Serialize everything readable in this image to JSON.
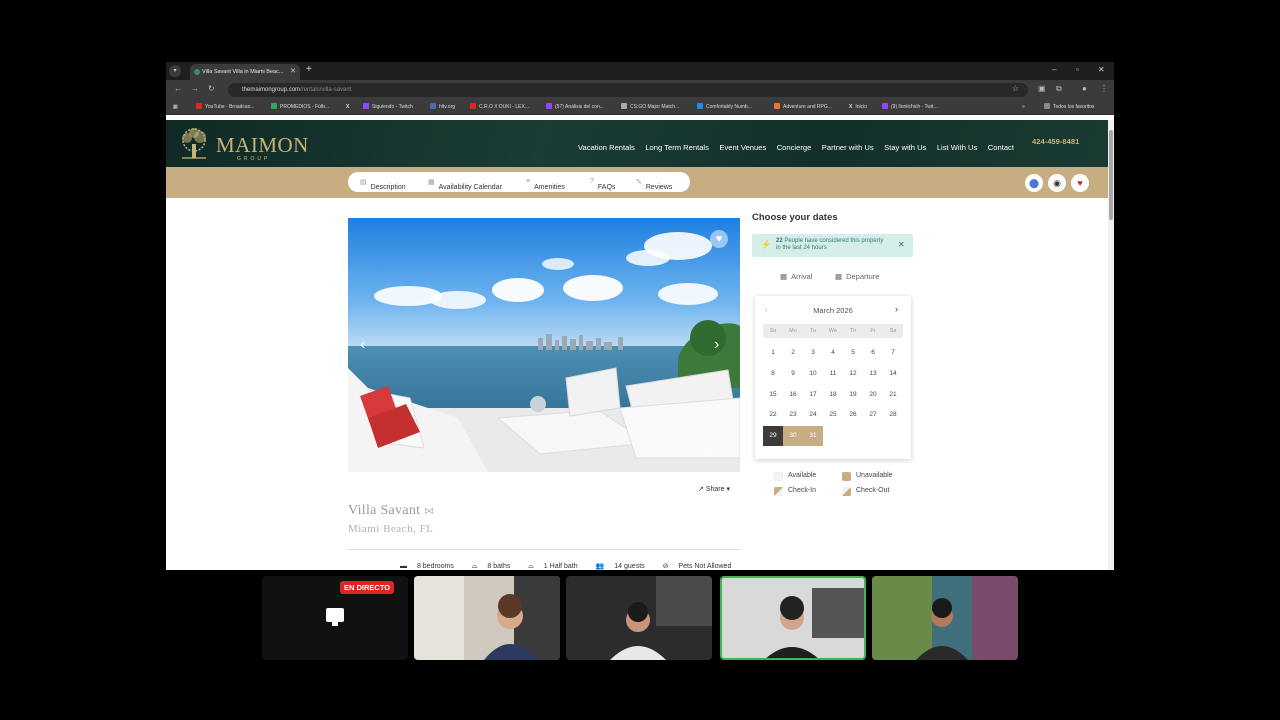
{
  "browser": {
    "tab_title": "Villa Savant Villa in Miami Beac...",
    "url_host": "themaimongroup.com",
    "url_path": "/rentals/villa-savant",
    "bookmarks": [
      {
        "label": "YouTube - Broadcas...",
        "color": "#e02424"
      },
      {
        "label": "PROMEDIOS - Fútb...",
        "color": "#3aa35a"
      },
      {
        "label": "",
        "color": "#000000"
      },
      {
        "label": "Siguiendo - Twitch",
        "color": "#9146ff"
      },
      {
        "label": "hltv.org",
        "color": "#4a6bb3"
      },
      {
        "label": "C.R.O X DUKI - LEX...",
        "color": "#e02424"
      },
      {
        "label": "(57) Análisis del con...",
        "color": "#9146ff"
      },
      {
        "label": "CS:GO Major Match...",
        "color": "#aaaaaa"
      },
      {
        "label": "Comfortably Numb...",
        "color": "#1e88e5"
      },
      {
        "label": "Adventure and RPG...",
        "color": "#e8772e"
      },
      {
        "label": "Inicio",
        "color": "#000000"
      },
      {
        "label": "(9) lloniichich - Twit...",
        "color": "#9146ff"
      }
    ],
    "bookmarks_folder": "Todos los favoritos"
  },
  "site": {
    "logo_text": "MAIMON",
    "logo_sub": "GROUP",
    "nav": [
      "Vacation Rentals",
      "Long Term Rentals",
      "Event Venues",
      "Concierge",
      "Partner with Us",
      "Stay with Us",
      "List With Us",
      "Contact"
    ],
    "phone": "424-459-8481",
    "subnav": [
      "Description",
      "Availability Calendar",
      "Amenities",
      "FAQs",
      "Reviews"
    ],
    "share": "Share",
    "villa_title": "Villa Savant",
    "villa_location": "Miami Beach, FL",
    "amenities": [
      "8 bedrooms",
      "8 baths",
      "1 Half bath",
      "14 guests",
      "Pets Not Allowed"
    ]
  },
  "booking": {
    "heading": "Choose your dates",
    "alert_count": "22",
    "alert_text": "People have considered this property in the last 24 hours",
    "arrival": "Arrival",
    "departure": "Departure",
    "month": "March 2026",
    "weekdays": [
      "Su",
      "Mo",
      "Tu",
      "We",
      "Th",
      "Fr",
      "Sa"
    ],
    "weeks": [
      [
        "1",
        "2",
        "3",
        "4",
        "5",
        "6",
        "7"
      ],
      [
        "8",
        "9",
        "10",
        "11",
        "12",
        "13",
        "14"
      ],
      [
        "15",
        "16",
        "17",
        "18",
        "19",
        "20",
        "21"
      ],
      [
        "22",
        "23",
        "24",
        "25",
        "26",
        "27",
        "28"
      ],
      [
        "29",
        "30",
        "31"
      ]
    ],
    "selected_day": "29",
    "range_days": [
      "30",
      "31"
    ],
    "legend": {
      "available": "Available",
      "unavailable": "Unavailable",
      "checkin": "Check-In",
      "checkout": "Check-Out"
    },
    "colors": {
      "accent": "#c7ae82",
      "selected": "#3d3a37",
      "alert_bg": "#d6eeea"
    }
  },
  "stream": {
    "live_badge": "EN DIRECTO"
  }
}
